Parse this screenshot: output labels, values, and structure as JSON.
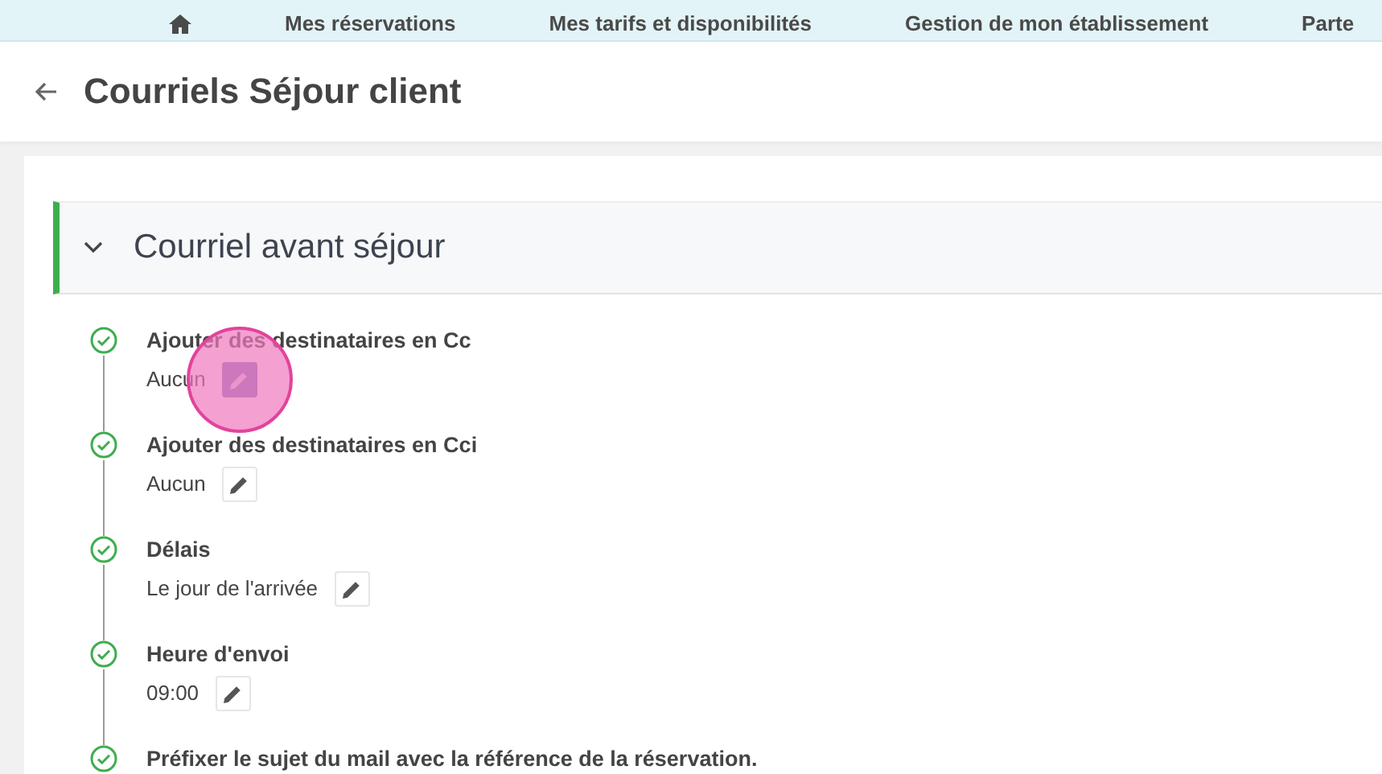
{
  "top_nav": {
    "items": [
      {
        "kind": "icon"
      },
      {
        "kind": "text",
        "label": "Mes réservations"
      },
      {
        "kind": "text",
        "label": "Mes tarifs et disponibilités"
      },
      {
        "kind": "text",
        "label": "Gestion de mon établissement"
      },
      {
        "kind": "text",
        "label": "Parte"
      }
    ]
  },
  "page_title": "Courriels Séjour client",
  "section": {
    "title": "Courriel avant séjour",
    "expanded": true,
    "steps": [
      {
        "title": "Ajouter des destinataires en Cc",
        "value": "Aucun",
        "done": true,
        "highlighted": true
      },
      {
        "title": "Ajouter des destinataires en Cci",
        "value": "Aucun",
        "done": true
      },
      {
        "title": "Délais",
        "value": "Le jour de l'arrivée",
        "done": true
      },
      {
        "title": "Heure d'envoi",
        "value": "09:00",
        "done": true
      },
      {
        "title": "Préfixer le sujet du mail avec la référence de la réservation.",
        "done": true
      }
    ]
  }
}
